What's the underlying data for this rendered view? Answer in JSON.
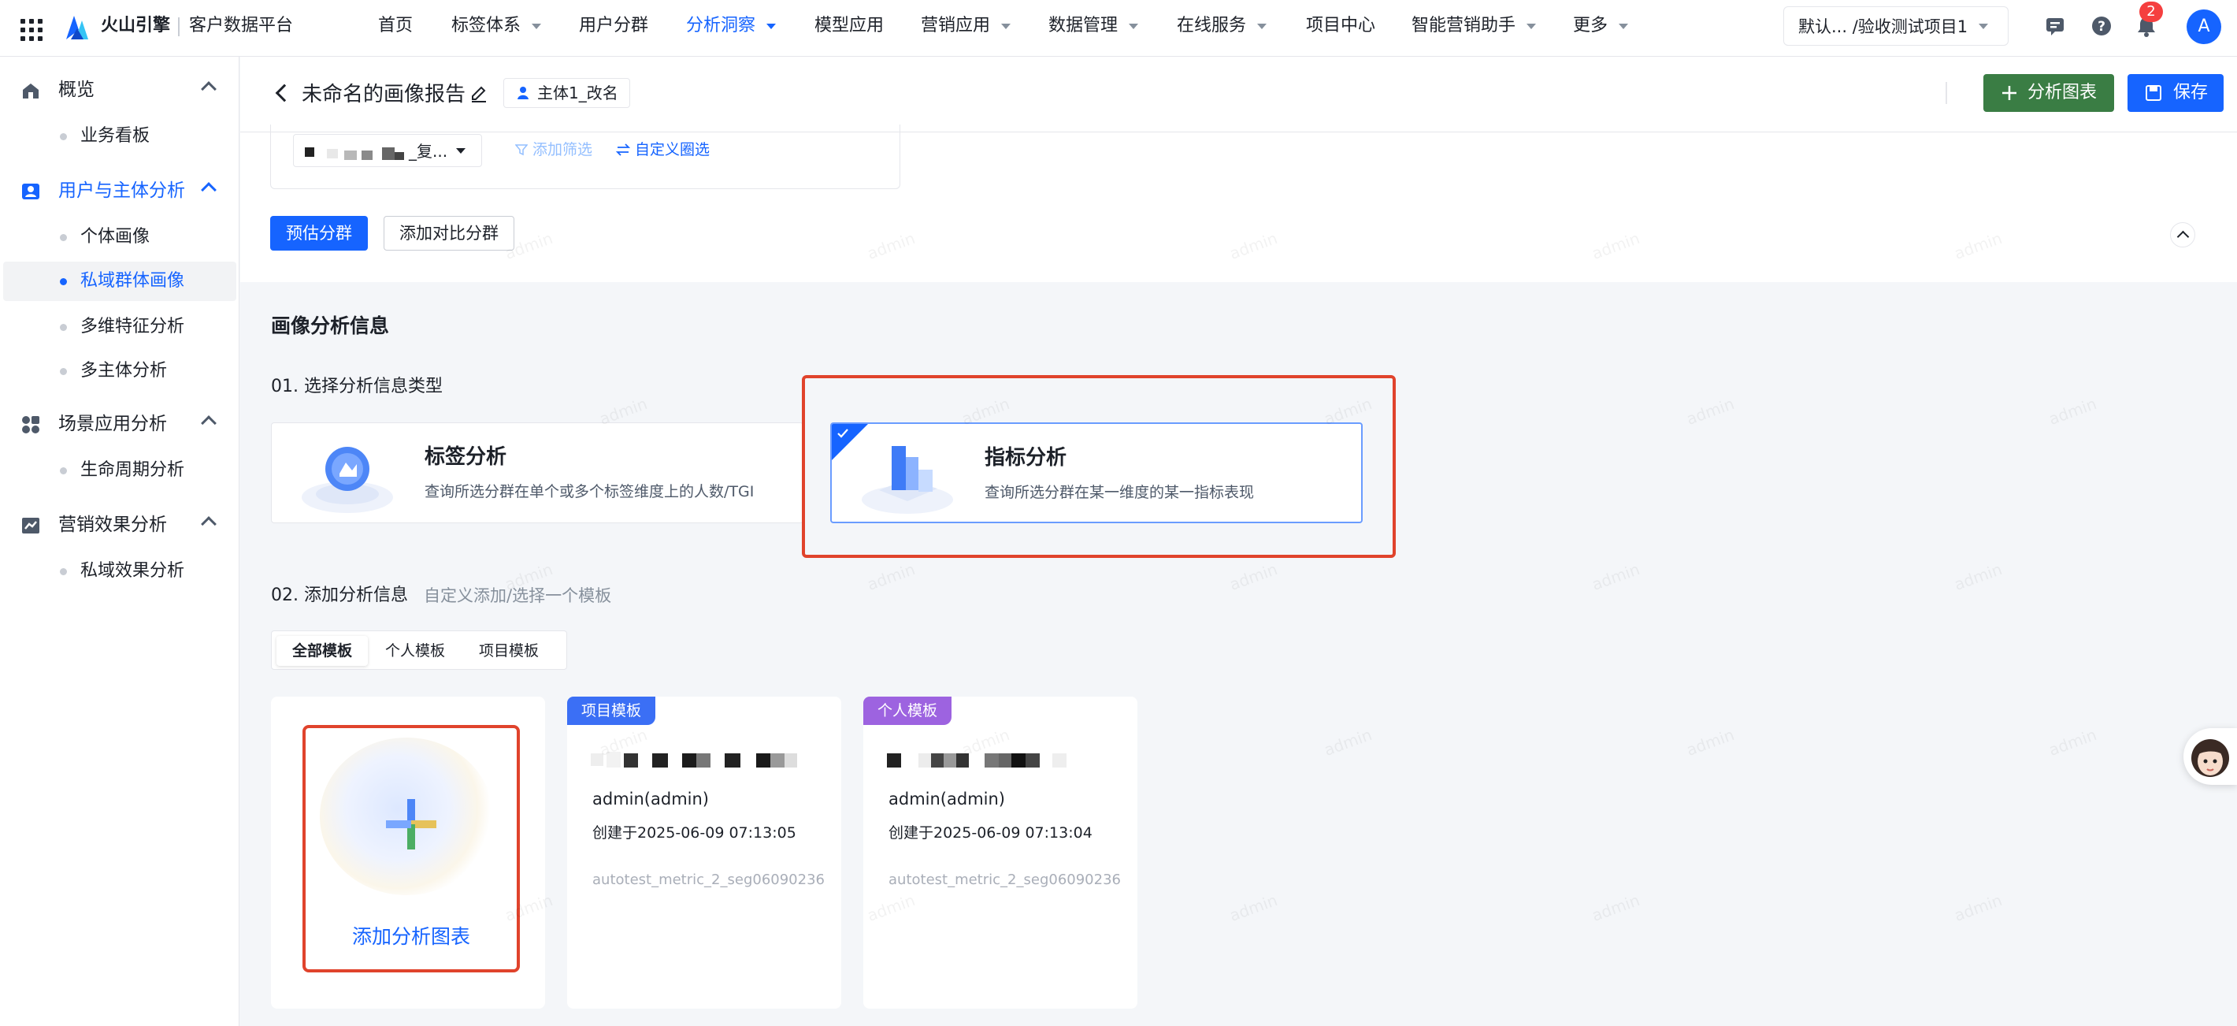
{
  "topnav": {
    "brand": "火山引擎",
    "platform": "客户数据平台",
    "items": [
      {
        "label": "首页",
        "dropdown": false,
        "active": false
      },
      {
        "label": "标签体系",
        "dropdown": true,
        "active": false
      },
      {
        "label": "用户分群",
        "dropdown": false,
        "active": false
      },
      {
        "label": "分析洞察",
        "dropdown": true,
        "active": true
      },
      {
        "label": "模型应用",
        "dropdown": false,
        "active": false
      },
      {
        "label": "营销应用",
        "dropdown": true,
        "active": false
      },
      {
        "label": "数据管理",
        "dropdown": true,
        "active": false
      },
      {
        "label": "在线服务",
        "dropdown": true,
        "active": false
      },
      {
        "label": "项目中心",
        "dropdown": false,
        "active": false
      },
      {
        "label": "智能营销助手",
        "dropdown": true,
        "active": false
      },
      {
        "label": "更多",
        "dropdown": true,
        "active": false
      }
    ],
    "project": "默认... /验收测试项目1",
    "notification_count": "2",
    "avatar_letter": "A"
  },
  "sidebar": {
    "groups": [
      {
        "label": "概览",
        "icon": "home-icon",
        "active": false,
        "items": [
          {
            "label": "业务看板",
            "active": false
          }
        ]
      },
      {
        "label": "用户与主体分析",
        "icon": "user-card-icon",
        "active": true,
        "items": [
          {
            "label": "个体画像",
            "active": false
          },
          {
            "label": "私域群体画像",
            "active": true
          },
          {
            "label": "多维特征分析",
            "active": false
          },
          {
            "label": "多主体分析",
            "active": false
          }
        ]
      },
      {
        "label": "场景应用分析",
        "icon": "apps-icon",
        "active": false,
        "items": [
          {
            "label": "生命周期分析",
            "active": false
          }
        ]
      },
      {
        "label": "营销效果分析",
        "icon": "trend-icon",
        "active": false,
        "items": [
          {
            "label": "私域效果分析",
            "active": false
          }
        ]
      }
    ]
  },
  "header": {
    "title": "未命名的画像报告",
    "subject": "主体1_改名",
    "chart_button": "分析图表",
    "save_button": "保存"
  },
  "filter": {
    "segment_text": "_复...",
    "add_filter": "添加筛选",
    "custom_select": "自定义圈选",
    "estimate_button": "预估分群",
    "compare_button": "添加对比分群"
  },
  "content": {
    "section_title": "画像分析信息",
    "step1": "01. 选择分析信息类型",
    "type_cards": [
      {
        "title": "标签分析",
        "desc": "查询所选分群在单个或多个标签维度上的人数/TGI",
        "selected": false
      },
      {
        "title": "指标分析",
        "desc": "查询所选分群在某一维度的某一指标表现",
        "selected": true
      }
    ],
    "step2": "02. 添加分析信息",
    "step2_hint": "自定义添加/选择一个模板",
    "tabs": [
      {
        "label": "全部模板",
        "active": true
      },
      {
        "label": "个人模板",
        "active": false
      },
      {
        "label": "项目模板",
        "active": false
      }
    ],
    "add_chart": "添加分析图表",
    "templates": [
      {
        "tag": "项目模板",
        "tag_color": "#3b6ff5",
        "owner": "admin(admin)",
        "created": "创建于2025-06-09 07:13:05",
        "name": "autotest_metric_2_seg06090236"
      },
      {
        "tag": "个人模板",
        "tag_color": "#9d63e0",
        "owner": "admin(admin)",
        "created": "创建于2025-06-09 07:13:04",
        "name": "autotest_metric_2_seg06090236"
      }
    ]
  },
  "colors": {
    "primary": "#1664ff",
    "chart_button": "#3a7d44",
    "highlight": "#e0432c",
    "badge": "#f53f3f"
  },
  "watermark": "admin"
}
